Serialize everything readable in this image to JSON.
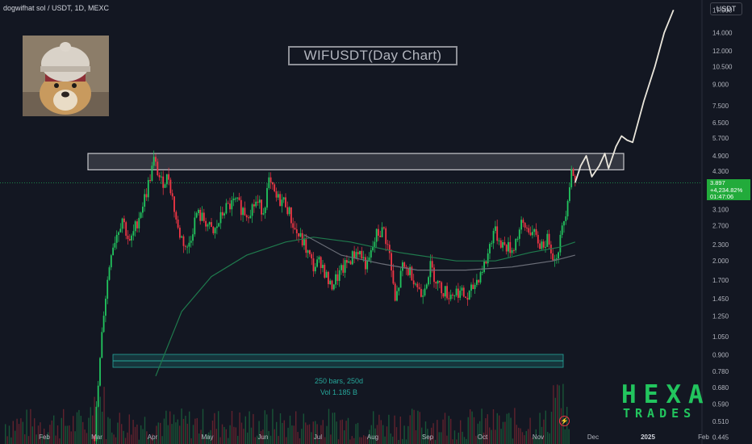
{
  "header": {
    "symbol_label": "dogwifhat sol / USDT, 1D, MEXC",
    "currency_button": "USDT"
  },
  "logo": {
    "name": "dogwifhat-logo-icon"
  },
  "watermark": {
    "line1": "HEXA",
    "line2": "TRADES",
    "color": "#22c55e"
  },
  "price_tag": {
    "price": "3.897",
    "change": "+4,234.82%",
    "countdown": "01:47:06"
  },
  "range_label": {
    "bars": "250 bars, 250d",
    "volume": "Vol 1.185 B"
  },
  "colors": {
    "up": "#22c55e",
    "down": "#f23645",
    "ma_green": "#1f7a4d",
    "ma_grey": "#6b6e78",
    "background": "#131722"
  },
  "chart_data": {
    "type": "candlestick",
    "title": "WIFUSDT(Day Chart)",
    "y_scale": "log",
    "ylim": [
      0.42,
      18.5
    ],
    "y_ticks": [
      "17.000",
      "14.000",
      "12.000",
      "10.500",
      "9.000",
      "7.500",
      "6.500",
      "5.700",
      "4.900",
      "4.300",
      "3.700",
      "3.100",
      "2.700",
      "2.300",
      "2.000",
      "1.700",
      "1.450",
      "1.250",
      "1.050",
      "0.900",
      "0.780",
      "0.680",
      "0.590",
      "0.510",
      "0.445"
    ],
    "x_ticks": [
      "Feb",
      "Mar",
      "Apr",
      "May",
      "Jun",
      "Jul",
      "Aug",
      "Sep",
      "Oct",
      "Nov",
      "Dec",
      "2025",
      "Feb"
    ],
    "grid": false,
    "resistance_zone": {
      "low": 4.35,
      "high": 5.0
    },
    "series": [
      {
        "name": "WIFUSDT",
        "points": [
          [
            "2024-02-28",
            0.45
          ],
          [
            "2024-03-04",
            1.3
          ],
          [
            "2024-03-08",
            2.2
          ],
          [
            "2024-03-14",
            2.9
          ],
          [
            "2024-03-18",
            2.3
          ],
          [
            "2024-03-22",
            2.8
          ],
          [
            "2024-03-27",
            3.6
          ],
          [
            "2024-03-31",
            4.7
          ],
          [
            "2024-04-04",
            3.9
          ],
          [
            "2024-04-08",
            4.1
          ],
          [
            "2024-04-13",
            2.6
          ],
          [
            "2024-04-18",
            2.2
          ],
          [
            "2024-04-23",
            3.0
          ],
          [
            "2024-04-28",
            2.8
          ],
          [
            "2024-05-02",
            2.5
          ],
          [
            "2024-05-08",
            3.1
          ],
          [
            "2024-05-14",
            3.3
          ],
          [
            "2024-05-20",
            3.0
          ],
          [
            "2024-05-25",
            3.3
          ],
          [
            "2024-05-29",
            3.1
          ],
          [
            "2024-06-01",
            3.9
          ],
          [
            "2024-06-05",
            3.4
          ],
          [
            "2024-06-10",
            3.3
          ],
          [
            "2024-06-15",
            2.6
          ],
          [
            "2024-06-20",
            2.3
          ],
          [
            "2024-06-25",
            1.9
          ],
          [
            "2024-06-29",
            2.0
          ],
          [
            "2024-07-04",
            1.6
          ],
          [
            "2024-07-08",
            1.75
          ],
          [
            "2024-07-14",
            2.0
          ],
          [
            "2024-07-19",
            2.2
          ],
          [
            "2024-07-24",
            1.9
          ],
          [
            "2024-07-29",
            2.5
          ],
          [
            "2024-08-02",
            2.6
          ],
          [
            "2024-08-05",
            2.1
          ],
          [
            "2024-08-08",
            1.4
          ],
          [
            "2024-08-12",
            1.9
          ],
          [
            "2024-08-17",
            1.8
          ],
          [
            "2024-08-22",
            1.5
          ],
          [
            "2024-08-27",
            1.9
          ],
          [
            "2024-09-01",
            1.6
          ],
          [
            "2024-09-06",
            1.5
          ],
          [
            "2024-09-11",
            1.55
          ],
          [
            "2024-09-16",
            1.45
          ],
          [
            "2024-09-21",
            1.7
          ],
          [
            "2024-09-26",
            2.0
          ],
          [
            "2024-09-30",
            2.6
          ],
          [
            "2024-10-05",
            2.3
          ],
          [
            "2024-10-10",
            2.2
          ],
          [
            "2024-10-15",
            2.7
          ],
          [
            "2024-10-20",
            2.6
          ],
          [
            "2024-10-25",
            2.3
          ],
          [
            "2024-10-30",
            2.4
          ],
          [
            "2024-11-02",
            2.0
          ],
          [
            "2024-11-05",
            2.4
          ],
          [
            "2024-11-08",
            3.1
          ],
          [
            "2024-11-11",
            4.4
          ],
          [
            "2024-11-13",
            3.9
          ]
        ]
      },
      {
        "name": "Projection",
        "points": [
          [
            "2024-11-13",
            3.9
          ],
          [
            "2024-11-16",
            4.5
          ],
          [
            "2024-11-19",
            4.9
          ],
          [
            "2024-11-22",
            4.1
          ],
          [
            "2024-11-26",
            4.5
          ],
          [
            "2024-11-29",
            5.0
          ],
          [
            "2024-12-01",
            4.4
          ],
          [
            "2024-12-05",
            5.3
          ],
          [
            "2024-12-08",
            5.8
          ],
          [
            "2024-12-11",
            5.6
          ],
          [
            "2024-12-14",
            5.5
          ],
          [
            "2024-12-20",
            7.8
          ],
          [
            "2024-12-26",
            10.5
          ],
          [
            "2024-12-31",
            14.0
          ],
          [
            "2025-01-05",
            17.0
          ]
        ]
      },
      {
        "name": "MA green",
        "points": [
          [
            "2024-04-01",
            0.75
          ],
          [
            "2024-04-15",
            1.3
          ],
          [
            "2024-05-01",
            1.75
          ],
          [
            "2024-05-20",
            2.1
          ],
          [
            "2024-06-10",
            2.35
          ],
          [
            "2024-06-25",
            2.45
          ],
          [
            "2024-07-15",
            2.35
          ],
          [
            "2024-08-10",
            2.15
          ],
          [
            "2024-09-10",
            2.0
          ],
          [
            "2024-10-01",
            2.0
          ],
          [
            "2024-10-20",
            2.15
          ],
          [
            "2024-11-05",
            2.25
          ],
          [
            "2024-11-13",
            2.35
          ]
        ]
      },
      {
        "name": "MA grey",
        "points": [
          [
            "2024-06-20",
            2.5
          ],
          [
            "2024-07-10",
            2.1
          ],
          [
            "2024-08-01",
            1.95
          ],
          [
            "2024-08-20",
            1.85
          ],
          [
            "2024-09-15",
            1.85
          ],
          [
            "2024-10-10",
            1.9
          ],
          [
            "2024-11-01",
            2.0
          ],
          [
            "2024-11-13",
            2.1
          ]
        ]
      }
    ]
  }
}
